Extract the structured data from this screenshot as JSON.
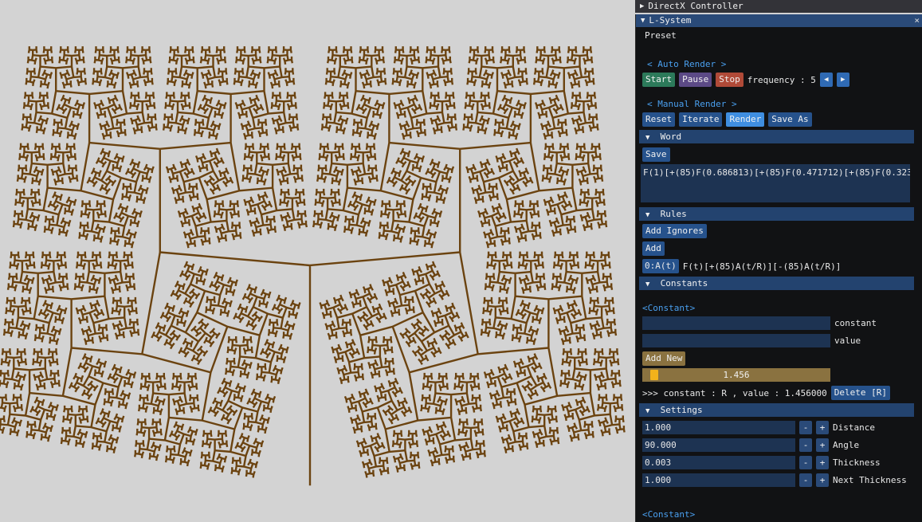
{
  "dx_controller": {
    "title": "DirectX Controller"
  },
  "lsystem": {
    "title": "L-System",
    "close_glyph": "×",
    "preset_label": "Preset",
    "auto_render": {
      "heading": "< Auto Render >",
      "start_label": "Start",
      "pause_label": "Pause",
      "stop_label": "Stop",
      "frequency_text": "frequency : 5"
    },
    "manual_render": {
      "heading": "< Manual Render >",
      "reset_label": "Reset",
      "iterate_label": "Iterate",
      "render_label": "Render",
      "save_as_label": "Save As"
    },
    "word": {
      "header": "Word",
      "save_label": "Save",
      "text": "F(1)[+(85)F(0.686813)[+(85)F(0.471712)[+(85)F(0.323"
    },
    "rules": {
      "header": "Rules",
      "add_ignores_label": "Add Ignores",
      "add_label": "Add",
      "rule_key": "0:A(t)",
      "rule_value": "F(t)[+(85)A(t/R)][-(85)A(t/R)]"
    },
    "constants": {
      "header": "Constants",
      "link_label": "<Constant>",
      "constant_field_label": "constant",
      "value_field_label": "value",
      "add_new_label": "Add New",
      "slider_value": "1.456",
      "slider_fraction": 0.03,
      "listing_text": ">>> constant : R  , value : 1.456000",
      "delete_label": "Delete [R]"
    },
    "settings": {
      "header": "Settings",
      "items": [
        {
          "value": "1.000",
          "label": "Distance"
        },
        {
          "value": "90.000",
          "label": "Angle"
        },
        {
          "value": "0.003",
          "label": "Thickness"
        },
        {
          "value": "1.000",
          "label": "Next Thickness"
        }
      ],
      "minus_glyph": "-",
      "plus_glyph": "+"
    },
    "footer_link": "<Constant>"
  },
  "colors": {
    "fractal_stroke": "#6b4310",
    "canvas_bg": "#d3d3d3",
    "panel_bg": "#111214"
  }
}
